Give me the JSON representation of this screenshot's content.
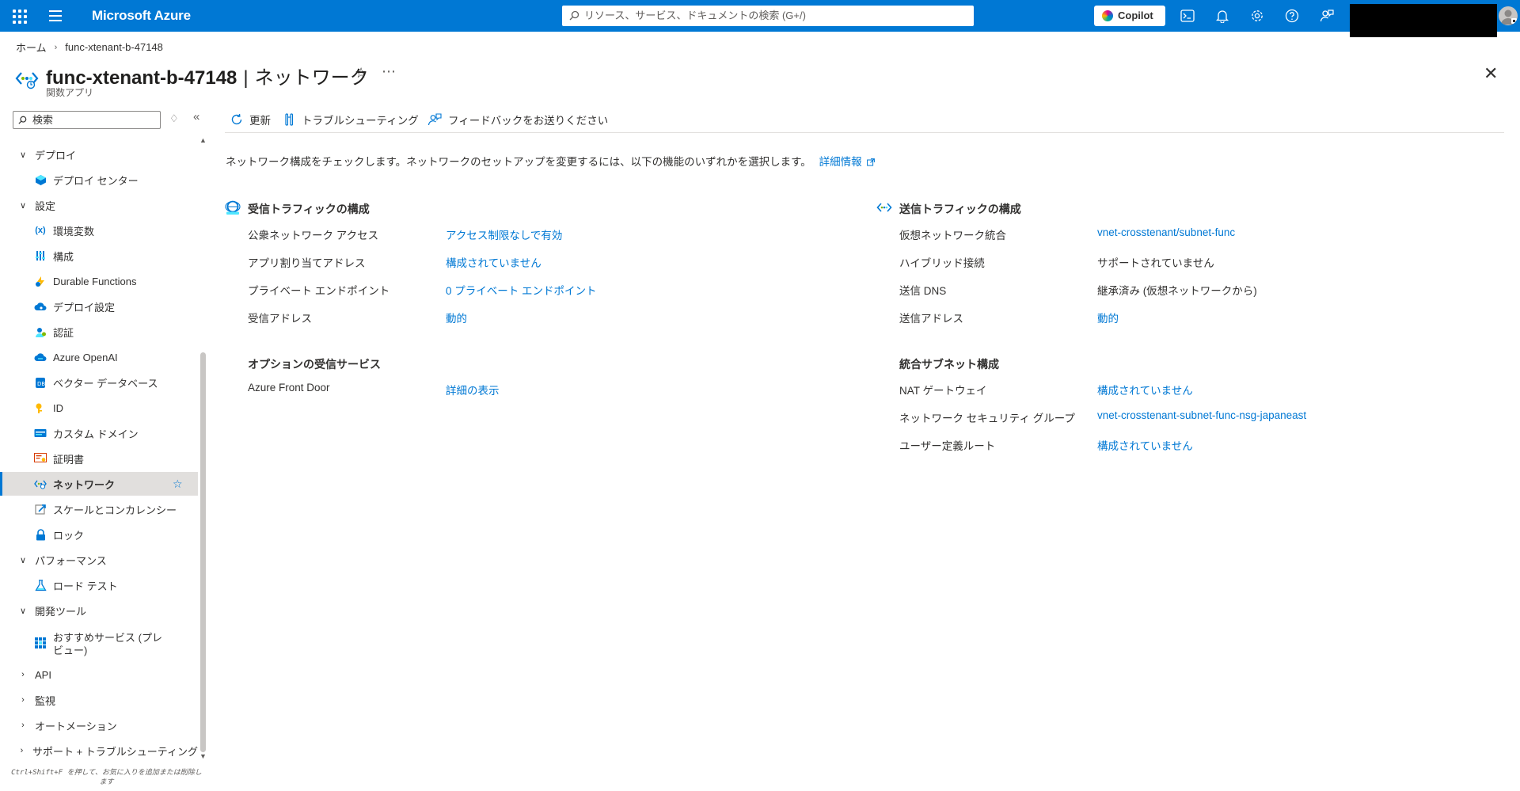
{
  "topbar": {
    "brand": "Microsoft Azure",
    "search_placeholder": "リソース、サービス、ドキュメントの検索 (G+/)",
    "copilot_label": "Copilot"
  },
  "breadcrumb": {
    "home": "ホーム",
    "resource": "func-xtenant-b-47148"
  },
  "header": {
    "resource_name": "func-xtenant-b-47148",
    "separator": "|",
    "page_name": "ネットワーク",
    "subtitle": "関数アプリ"
  },
  "sidebar": {
    "search_placeholder": "検索",
    "items": [
      {
        "kind": "group",
        "label": "デプロイ",
        "expanded": true
      },
      {
        "kind": "sub",
        "label": "デプロイ センター",
        "icon": "deploy-center-icon"
      },
      {
        "kind": "group",
        "label": "設定",
        "expanded": true
      },
      {
        "kind": "sub",
        "label": "環境変数",
        "icon": "environment-variables-icon"
      },
      {
        "kind": "sub",
        "label": "構成",
        "icon": "configuration-icon"
      },
      {
        "kind": "sub",
        "label": "Durable Functions",
        "icon": "durable-functions-icon"
      },
      {
        "kind": "sub",
        "label": "デプロイ設定",
        "icon": "deployment-settings-icon"
      },
      {
        "kind": "sub",
        "label": "認証",
        "icon": "authentication-icon"
      },
      {
        "kind": "sub",
        "label": "Azure OpenAI",
        "icon": "azure-openai-icon"
      },
      {
        "kind": "sub",
        "label": "ベクター データベース",
        "icon": "vector-database-icon"
      },
      {
        "kind": "sub",
        "label": "ID",
        "icon": "identity-icon"
      },
      {
        "kind": "sub",
        "label": "カスタム ドメイン",
        "icon": "custom-domain-icon"
      },
      {
        "kind": "sub",
        "label": "証明書",
        "icon": "certificate-icon"
      },
      {
        "kind": "sub",
        "label": "ネットワーク",
        "icon": "networking-icon",
        "active": true
      },
      {
        "kind": "sub",
        "label": "スケールとコンカレンシー",
        "icon": "scale-icon"
      },
      {
        "kind": "sub",
        "label": "ロック",
        "icon": "lock-icon"
      },
      {
        "kind": "group",
        "label": "パフォーマンス",
        "expanded": true
      },
      {
        "kind": "sub",
        "label": "ロード テスト",
        "icon": "load-test-icon"
      },
      {
        "kind": "group",
        "label": "開発ツール",
        "expanded": true
      },
      {
        "kind": "sub",
        "label": "おすすめサービス (プレビュー)",
        "icon": "recommended-services-icon"
      },
      {
        "kind": "group",
        "label": "API",
        "expanded": false
      },
      {
        "kind": "group",
        "label": "監視",
        "expanded": false
      },
      {
        "kind": "group",
        "label": "オートメーション",
        "expanded": false
      },
      {
        "kind": "group",
        "label": "サポート + トラブルシューティング",
        "expanded": false
      }
    ],
    "hint": "Ctrl+Shift+F を押して、お気に入りを追加または削除します"
  },
  "toolbar": {
    "refresh": "更新",
    "troubleshoot": "トラブルシューティング",
    "feedback": "フィードバックをお送りください"
  },
  "intro": {
    "text": "ネットワーク構成をチェックします。ネットワークのセットアップを変更するには、以下の機能のいずれかを選択します。",
    "link": "詳細情報"
  },
  "inbound": {
    "title": "受信トラフィックの構成",
    "rows": [
      {
        "label": "公衆ネットワーク アクセス",
        "value": "アクセス制限なしで有効",
        "link": true
      },
      {
        "label": "アプリ割り当てアドレス",
        "value": "構成されていません",
        "link": true
      },
      {
        "label": "プライベート エンドポイント",
        "value": "0 プライベート エンドポイント",
        "link": true
      },
      {
        "label": "受信アドレス",
        "value": "動的",
        "link": true
      }
    ]
  },
  "optional_inbound": {
    "title": "オプションの受信サービス",
    "rows": [
      {
        "label": "Azure Front Door",
        "value": "詳細の表示",
        "link": true
      }
    ]
  },
  "outbound": {
    "title": "送信トラフィックの構成",
    "rows": [
      {
        "label": "仮想ネットワーク統合",
        "value": "vnet-crosstenant/subnet-func",
        "link": true
      },
      {
        "label": "ハイブリッド接続",
        "value": "サポートされていません",
        "link": false
      },
      {
        "label": "送信 DNS",
        "value": "継承済み (仮想ネットワークから)",
        "link": false
      },
      {
        "label": "送信アドレス",
        "value": "動的",
        "link": true
      }
    ]
  },
  "subnet": {
    "title": "統合サブネット構成",
    "rows": [
      {
        "label": "NAT ゲートウェイ",
        "value": "構成されていません",
        "link": true
      },
      {
        "label": "ネットワーク セキュリティ グループ",
        "value": "vnet-crosstenant-subnet-func-nsg-japaneast",
        "link": true
      },
      {
        "label": "ユーザー定義ルート",
        "value": "構成されていません",
        "link": true
      }
    ]
  },
  "colors": {
    "azure_blue": "#0078d4",
    "link": "#0078d4",
    "text": "#323130",
    "active_bg": "#e1dfdd"
  }
}
